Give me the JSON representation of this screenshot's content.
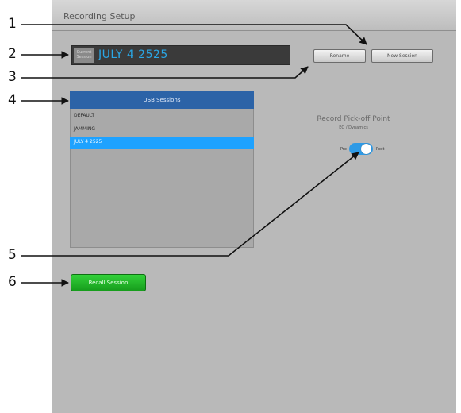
{
  "window": {
    "title": "Recording Setup"
  },
  "session": {
    "caption": "Current Session",
    "name": "JULY 4 2525"
  },
  "toolbar": {
    "rename_label": "Rename",
    "new_session_label": "New Session"
  },
  "sessions_list": {
    "header": "USB Sessions",
    "items": [
      "DEFAULT",
      "JAMMING",
      "JULY 4 2525"
    ],
    "selected_index": 2
  },
  "pickoff": {
    "title": "Record Pick-off Point",
    "subtitle": "EQ / Dynamics",
    "pre_label": "Pre",
    "post_label": "Post",
    "selected": "Post"
  },
  "recall": {
    "label": "Recall Session"
  },
  "callouts": [
    "1",
    "2",
    "3",
    "4",
    "5",
    "6"
  ],
  "colors": {
    "accent_blue": "#1ea2ff",
    "header_blue": "#2c63a7",
    "recall_green": "#1fb526",
    "session_text": "#2aa7e6"
  }
}
